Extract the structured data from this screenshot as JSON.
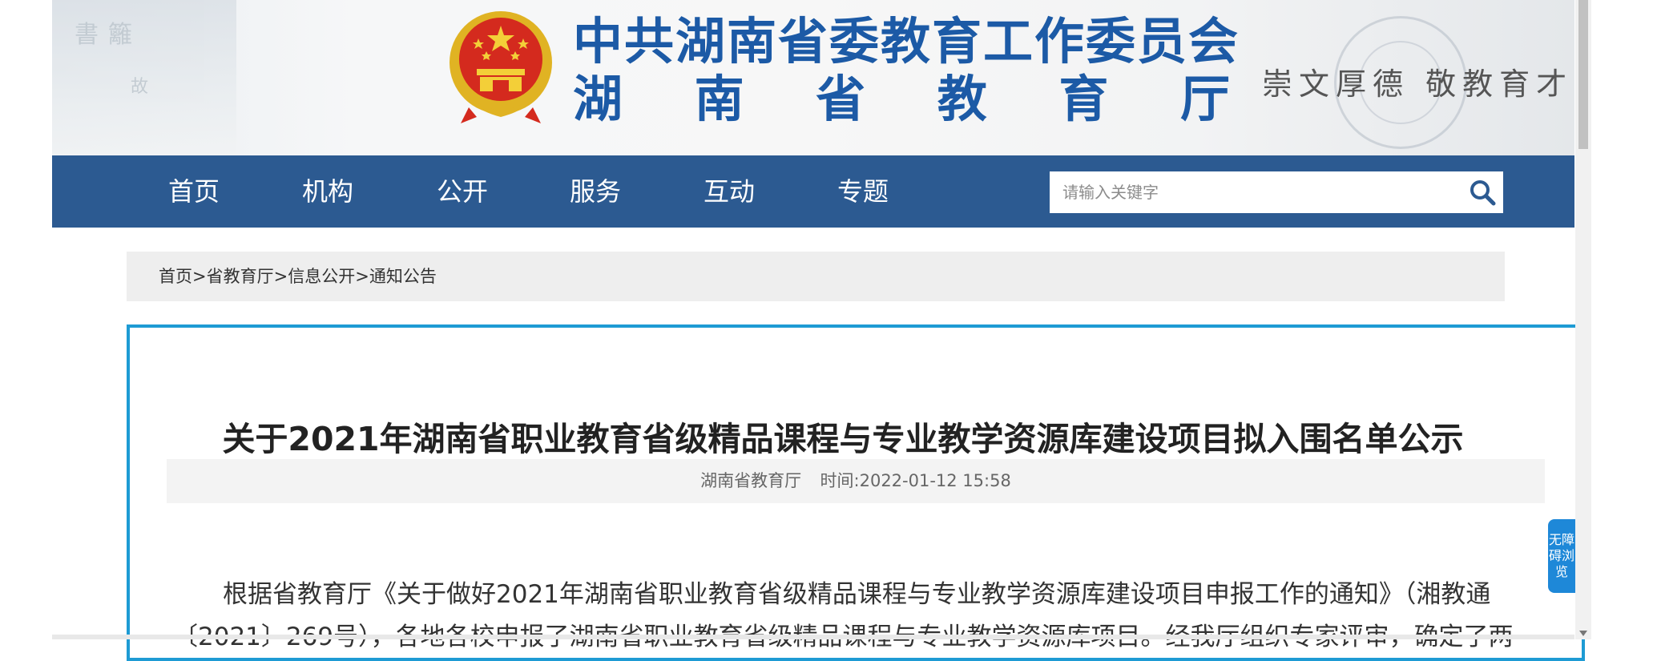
{
  "header": {
    "title_line1": "中共湖南省委教育工作委员会",
    "title_line2": [
      "湖",
      "南",
      "省",
      "教",
      "育",
      "厅"
    ],
    "slogan": "崇文厚德  敬教育才"
  },
  "nav": {
    "items": [
      {
        "label": "首页"
      },
      {
        "label": "机构"
      },
      {
        "label": "公开"
      },
      {
        "label": "服务"
      },
      {
        "label": "互动"
      },
      {
        "label": "专题"
      }
    ]
  },
  "search": {
    "placeholder": "请输入关键字",
    "value": ""
  },
  "breadcrumb": {
    "items": [
      "首页",
      "省教育厅",
      "信息公开",
      "通知公告"
    ],
    "separator": ">"
  },
  "article": {
    "title": "关于2021年湖南省职业教育省级精品课程与专业教学资源库建设项目拟入围名单公示",
    "source": "湖南省教育厅",
    "time_label": "时间:",
    "time": "2022-01-12 15:58",
    "paragraph": "根据省教育厅《关于做好2021年湖南省职业教育省级精品课程与专业教学资源库建设项目申报工作的通知》（湘教通〔2021〕269号），各地各校申报了湖南省职业教育省级精品课程与专业教学资源库项目。经我厅组织专家评审，确定了两"
  },
  "accessibility": {
    "label": "无障碍浏览"
  },
  "colors": {
    "nav_bg": "#2c5a91",
    "title_blue": "#1c5aa6",
    "article_border": "#1e9bd4",
    "access_tab": "#1e88d8"
  },
  "icons": {
    "search": "search-icon",
    "emblem": "national-emblem-icon"
  }
}
